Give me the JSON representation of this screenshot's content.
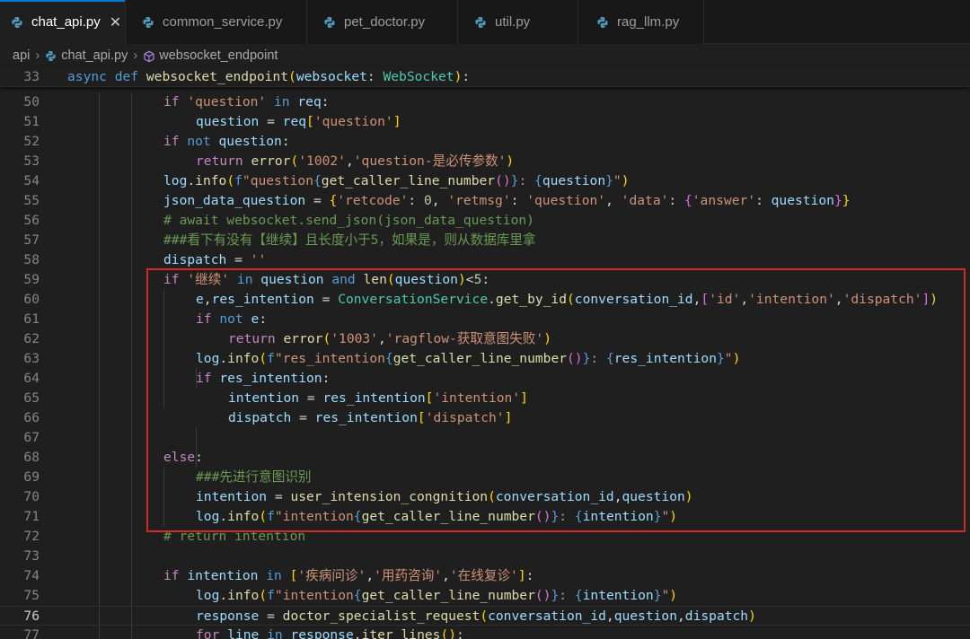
{
  "tabs": [
    {
      "label": "chat_api.py",
      "active": true,
      "close": "✕"
    },
    {
      "label": "common_service.py"
    },
    {
      "label": "pet_doctor.py"
    },
    {
      "label": "util.py"
    },
    {
      "label": "rag_llm.py"
    }
  ],
  "breadcrumb": {
    "folder": "api",
    "file": "chat_api.py",
    "symbol": "websocket_endpoint",
    "sep": "›"
  },
  "colors": {
    "python_icon": "#519aba",
    "highlight_box": "#d12a26",
    "active_tab_accent": "#0078d4"
  },
  "current_line": 76,
  "lines": [
    {
      "n": 33,
      "tokens": [
        [
          "kw",
          "async "
        ],
        [
          "kw",
          "def "
        ],
        [
          "fn",
          "websocket_endpoint"
        ],
        [
          "br1",
          "("
        ],
        [
          "var",
          "websocket"
        ],
        [
          "op",
          ": "
        ],
        [
          "cls",
          "WebSocket"
        ],
        [
          "br1",
          ")"
        ],
        [
          "op",
          ":"
        ]
      ]
    },
    {
      "n": 50,
      "tokens": [
        [
          "ctl",
          "if "
        ],
        [
          "str",
          "'question'"
        ],
        [
          "kw",
          " in "
        ],
        [
          "var",
          "req"
        ],
        [
          "op",
          ":"
        ]
      ]
    },
    {
      "n": 51,
      "tokens": [
        [
          "var",
          "question"
        ],
        [
          "op",
          " = "
        ],
        [
          "var",
          "req"
        ],
        [
          "br1",
          "["
        ],
        [
          "str",
          "'question'"
        ],
        [
          "br1",
          "]"
        ]
      ]
    },
    {
      "n": 52,
      "tokens": [
        [
          "ctl",
          "if "
        ],
        [
          "kw",
          "not "
        ],
        [
          "var",
          "question"
        ],
        [
          "op",
          ":"
        ]
      ]
    },
    {
      "n": 53,
      "tokens": [
        [
          "ctl",
          "return "
        ],
        [
          "fn",
          "error"
        ],
        [
          "br1",
          "("
        ],
        [
          "str",
          "'1002'"
        ],
        [
          "op",
          ","
        ],
        [
          "str",
          "'question-是必传参数'"
        ],
        [
          "br1",
          ")"
        ]
      ]
    },
    {
      "n": 54,
      "tokens": [
        [
          "var",
          "log"
        ],
        [
          "op",
          "."
        ],
        [
          "fn",
          "info"
        ],
        [
          "br1",
          "("
        ],
        [
          "fmt",
          "f"
        ],
        [
          "str",
          "\"question"
        ],
        [
          "fmt",
          "{"
        ],
        [
          "fn",
          "get_caller_line_number"
        ],
        [
          "br2",
          "()"
        ],
        [
          "fmt",
          "}"
        ],
        [
          "str",
          ": "
        ],
        [
          "fmt",
          "{"
        ],
        [
          "var",
          "question"
        ],
        [
          "fmt",
          "}"
        ],
        [
          "str",
          "\""
        ],
        [
          "br1",
          ")"
        ]
      ]
    },
    {
      "n": 55,
      "tokens": [
        [
          "var",
          "json_data_question"
        ],
        [
          "op",
          " = "
        ],
        [
          "br1",
          "{"
        ],
        [
          "str",
          "'retcode'"
        ],
        [
          "op",
          ": "
        ],
        [
          "num",
          "0"
        ],
        [
          "op",
          ", "
        ],
        [
          "str",
          "'retmsg'"
        ],
        [
          "op",
          ": "
        ],
        [
          "str",
          "'question'"
        ],
        [
          "op",
          ", "
        ],
        [
          "str",
          "'data'"
        ],
        [
          "op",
          ": "
        ],
        [
          "br2",
          "{"
        ],
        [
          "str",
          "'answer'"
        ],
        [
          "op",
          ": "
        ],
        [
          "var",
          "question"
        ],
        [
          "br2",
          "}"
        ],
        [
          "br1",
          "}"
        ]
      ]
    },
    {
      "n": 56,
      "tokens": [
        [
          "cm",
          "# await websocket.send_json(json_data_question)"
        ]
      ]
    },
    {
      "n": 57,
      "tokens": [
        [
          "cm",
          "###看下有没有【继续】且长度小于5，如果是，则从数据库里拿"
        ]
      ]
    },
    {
      "n": 58,
      "tokens": [
        [
          "var",
          "dispatch"
        ],
        [
          "op",
          " = "
        ],
        [
          "str",
          "''"
        ]
      ]
    },
    {
      "n": 59,
      "tokens": [
        [
          "ctl",
          "if "
        ],
        [
          "str",
          "'继续'"
        ],
        [
          "kw",
          " in "
        ],
        [
          "var",
          "question"
        ],
        [
          "kw",
          " and "
        ],
        [
          "fn",
          "len"
        ],
        [
          "br1",
          "("
        ],
        [
          "var",
          "question"
        ],
        [
          "br1",
          ")"
        ],
        [
          "op",
          "<"
        ],
        [
          "num",
          "5"
        ],
        [
          "op",
          ":"
        ]
      ]
    },
    {
      "n": 60,
      "tokens": [
        [
          "var",
          "e"
        ],
        [
          "op",
          ","
        ],
        [
          "var",
          "res_intention"
        ],
        [
          "op",
          " = "
        ],
        [
          "cls",
          "ConversationService"
        ],
        [
          "op",
          "."
        ],
        [
          "fn",
          "get_by_id"
        ],
        [
          "br1",
          "("
        ],
        [
          "var",
          "conversation_id"
        ],
        [
          "op",
          ","
        ],
        [
          "br2",
          "["
        ],
        [
          "str",
          "'id'"
        ],
        [
          "op",
          ","
        ],
        [
          "str",
          "'intention'"
        ],
        [
          "op",
          ","
        ],
        [
          "str",
          "'dispatch'"
        ],
        [
          "br2",
          "]"
        ],
        [
          "br1",
          ")"
        ]
      ]
    },
    {
      "n": 61,
      "tokens": [
        [
          "ctl",
          "if "
        ],
        [
          "kw",
          "not "
        ],
        [
          "var",
          "e"
        ],
        [
          "op",
          ":"
        ]
      ]
    },
    {
      "n": 62,
      "tokens": [
        [
          "ctl",
          "return "
        ],
        [
          "fn",
          "error"
        ],
        [
          "br1",
          "("
        ],
        [
          "str",
          "'1003'"
        ],
        [
          "op",
          ","
        ],
        [
          "str",
          "'ragflow-获取意图失败'"
        ],
        [
          "br1",
          ")"
        ]
      ]
    },
    {
      "n": 63,
      "tokens": [
        [
          "var",
          "log"
        ],
        [
          "op",
          "."
        ],
        [
          "fn",
          "info"
        ],
        [
          "br1",
          "("
        ],
        [
          "fmt",
          "f"
        ],
        [
          "str",
          "\"res_intention"
        ],
        [
          "fmt",
          "{"
        ],
        [
          "fn",
          "get_caller_line_number"
        ],
        [
          "br2",
          "()"
        ],
        [
          "fmt",
          "}"
        ],
        [
          "str",
          ": "
        ],
        [
          "fmt",
          "{"
        ],
        [
          "var",
          "res_intention"
        ],
        [
          "fmt",
          "}"
        ],
        [
          "str",
          "\""
        ],
        [
          "br1",
          ")"
        ]
      ]
    },
    {
      "n": 64,
      "tokens": [
        [
          "ctl",
          "if "
        ],
        [
          "var",
          "res_intention"
        ],
        [
          "op",
          ":"
        ]
      ]
    },
    {
      "n": 65,
      "tokens": [
        [
          "var",
          "intention"
        ],
        [
          "op",
          " = "
        ],
        [
          "var",
          "res_intention"
        ],
        [
          "br1",
          "["
        ],
        [
          "str",
          "'intention'"
        ],
        [
          "br1",
          "]"
        ]
      ]
    },
    {
      "n": 66,
      "tokens": [
        [
          "var",
          "dispatch"
        ],
        [
          "op",
          " = "
        ],
        [
          "var",
          "res_intention"
        ],
        [
          "br1",
          "["
        ],
        [
          "str",
          "'dispatch'"
        ],
        [
          "br1",
          "]"
        ]
      ]
    },
    {
      "n": 67,
      "tokens": []
    },
    {
      "n": 68,
      "tokens": [
        [
          "ctl",
          "else"
        ],
        [
          "op",
          ":"
        ]
      ]
    },
    {
      "n": 69,
      "tokens": [
        [
          "cm",
          "###先进行意图识别"
        ]
      ]
    },
    {
      "n": 70,
      "tokens": [
        [
          "var",
          "intention"
        ],
        [
          "op",
          " = "
        ],
        [
          "fn",
          "user_intension_congnition"
        ],
        [
          "br1",
          "("
        ],
        [
          "var",
          "conversation_id"
        ],
        [
          "op",
          ","
        ],
        [
          "var",
          "question"
        ],
        [
          "br1",
          ")"
        ]
      ]
    },
    {
      "n": 71,
      "tokens": [
        [
          "var",
          "log"
        ],
        [
          "op",
          "."
        ],
        [
          "fn",
          "info"
        ],
        [
          "br1",
          "("
        ],
        [
          "fmt",
          "f"
        ],
        [
          "str",
          "\"intention"
        ],
        [
          "fmt",
          "{"
        ],
        [
          "fn",
          "get_caller_line_number"
        ],
        [
          "br2",
          "()"
        ],
        [
          "fmt",
          "}"
        ],
        [
          "str",
          ": "
        ],
        [
          "fmt",
          "{"
        ],
        [
          "var",
          "intention"
        ],
        [
          "fmt",
          "}"
        ],
        [
          "str",
          "\""
        ],
        [
          "br1",
          ")"
        ]
      ]
    },
    {
      "n": 72,
      "tokens": [
        [
          "cm",
          "# return intention"
        ]
      ]
    },
    {
      "n": 73,
      "tokens": []
    },
    {
      "n": 74,
      "tokens": [
        [
          "ctl",
          "if "
        ],
        [
          "var",
          "intention"
        ],
        [
          "kw",
          " in "
        ],
        [
          "br1",
          "["
        ],
        [
          "str",
          "'疾病问诊'"
        ],
        [
          "op",
          ","
        ],
        [
          "str",
          "'用药咨询'"
        ],
        [
          "op",
          ","
        ],
        [
          "str",
          "'在线复诊'"
        ],
        [
          "br1",
          "]"
        ],
        [
          "op",
          ":"
        ]
      ]
    },
    {
      "n": 75,
      "tokens": [
        [
          "var",
          "log"
        ],
        [
          "op",
          "."
        ],
        [
          "fn",
          "info"
        ],
        [
          "br1",
          "("
        ],
        [
          "fmt",
          "f"
        ],
        [
          "str",
          "\"intention"
        ],
        [
          "fmt",
          "{"
        ],
        [
          "fn",
          "get_caller_line_number"
        ],
        [
          "br2",
          "()"
        ],
        [
          "fmt",
          "}"
        ],
        [
          "str",
          ": "
        ],
        [
          "fmt",
          "{"
        ],
        [
          "var",
          "intention"
        ],
        [
          "fmt",
          "}"
        ],
        [
          "str",
          "\""
        ],
        [
          "br1",
          ")"
        ]
      ]
    },
    {
      "n": 76,
      "tokens": [
        [
          "var",
          "response"
        ],
        [
          "op",
          " = "
        ],
        [
          "fn",
          "doctor_specialist_request"
        ],
        [
          "br1",
          "("
        ],
        [
          "var",
          "conversation_id"
        ],
        [
          "op",
          ","
        ],
        [
          "var",
          "question"
        ],
        [
          "op",
          ","
        ],
        [
          "var",
          "dispatch"
        ],
        [
          "br1",
          ")"
        ]
      ]
    },
    {
      "n": 77,
      "tokens": [
        [
          "ctl",
          "for "
        ],
        [
          "var",
          "line"
        ],
        [
          "kw",
          " in "
        ],
        [
          "var",
          "response"
        ],
        [
          "op",
          "."
        ],
        [
          "fn",
          "iter_lines"
        ],
        [
          "br1",
          "("
        ],
        [
          "br1",
          ")"
        ],
        [
          "op",
          ":"
        ]
      ]
    }
  ]
}
